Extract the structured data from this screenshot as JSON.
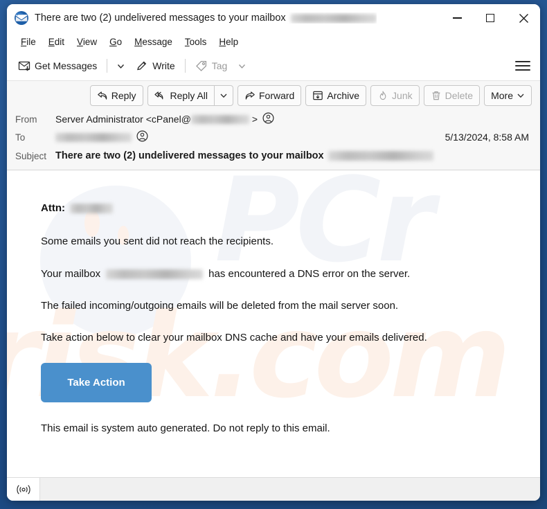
{
  "window": {
    "title": "There are two (2) undelivered messages to your mailbox",
    "app_icon": "thunderbird-icon",
    "controls": {
      "minimize": "minimize-icon",
      "maximize": "maximize-icon",
      "close": "close-icon"
    }
  },
  "menu_bar": {
    "items": [
      {
        "label": "File",
        "accel": "F"
      },
      {
        "label": "Edit",
        "accel": "E"
      },
      {
        "label": "View",
        "accel": "V"
      },
      {
        "label": "Go",
        "accel": "G"
      },
      {
        "label": "Message",
        "accel": "M"
      },
      {
        "label": "Tools",
        "accel": "T"
      },
      {
        "label": "Help",
        "accel": "H"
      }
    ]
  },
  "toolbar": {
    "get_messages_label": "Get Messages",
    "write_label": "Write",
    "tag_label": "Tag",
    "menu_label": "Application Menu"
  },
  "message_actions": {
    "reply": "Reply",
    "reply_all": "Reply All",
    "forward": "Forward",
    "archive": "Archive",
    "junk": "Junk",
    "delete": "Delete",
    "more": "More"
  },
  "headers": {
    "from_label": "From",
    "from_name": "Server Administrator",
    "from_address_prefix": "<cPanel@",
    "from_address_suffix": ">",
    "to_label": "To",
    "subject_label": "Subject",
    "subject_text": "There are two (2) undelivered messages to your mailbox",
    "date": "5/13/2024, 8:58 AM"
  },
  "body": {
    "attn_label": "Attn:",
    "line_1": "Some emails you sent did not reach the recipients.",
    "line_2_prefix": "Your mailbox",
    "line_2_suffix": "has encountered a DNS error on the server.",
    "line_3": "The failed incoming/outgoing emails will be deleted from the mail server soon.",
    "line_4": "Take action below to clear your mailbox DNS cache and have your emails delivered.",
    "cta_label": "Take Action",
    "footer": "This email is system auto generated. Do not reply to this email.",
    "watermark_top": "PCr",
    "watermark_bottom": "risk.com"
  },
  "status_bar": {
    "online_icon": "broadcast-icon"
  },
  "colors": {
    "desktop": "#1f5496",
    "cta_button": "#4a90cc",
    "header_pane": "#f7f7f7",
    "status_bar": "#f0f0f0"
  }
}
